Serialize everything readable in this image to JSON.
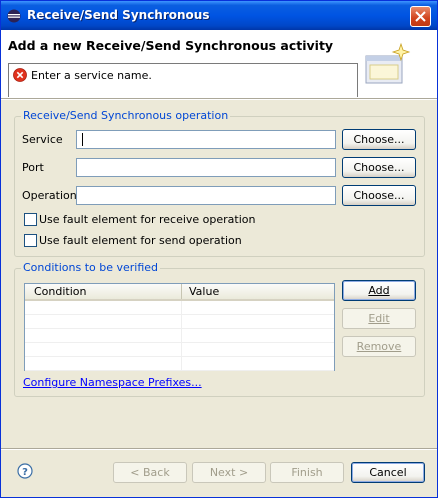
{
  "window": {
    "title": "Receive/Send Synchronous"
  },
  "header": {
    "title": "Add a new Receive/Send Synchronous activity",
    "message": "Enter a service name."
  },
  "operation_group": {
    "title": "Receive/Send Synchronous operation",
    "service_label": "Service",
    "service_value": "",
    "port_label": "Port",
    "port_value": "",
    "operation_label": "Operation",
    "operation_value": "",
    "choose_label": "Choose...",
    "fault_receive_label": "Use fault element for receive operation",
    "fault_receive_checked": false,
    "fault_send_label": "Use fault element for send operation",
    "fault_send_checked": false
  },
  "conditions_group": {
    "title": "Conditions to be verified",
    "columns": [
      "Condition",
      "Value"
    ],
    "rows": [],
    "add_label": "Add",
    "edit_label": "Edit",
    "remove_label": "Remove",
    "namespace_link": "Configure Namespace Prefixes..."
  },
  "footer": {
    "back_label": "< Back",
    "next_label": "Next >",
    "finish_label": "Finish",
    "cancel_label": "Cancel"
  },
  "icons": {
    "app": "eclipse-icon",
    "close": "close-icon",
    "error": "error-icon",
    "banner": "wizard-banner-icon",
    "help": "help-icon"
  },
  "colors": {
    "titlebar": "#0054e3",
    "dialog_bg": "#ece9d8",
    "group_title": "#0046d5",
    "error_red": "#e0321e",
    "link": "#0000ff"
  }
}
